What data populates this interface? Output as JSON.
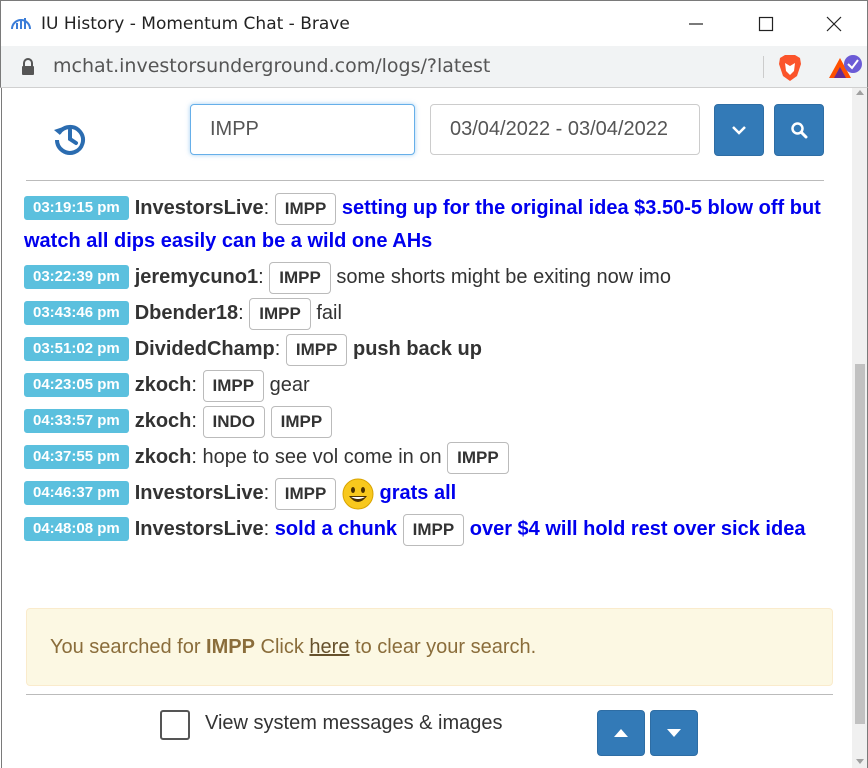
{
  "window": {
    "title": "IU History - Momentum Chat - Brave",
    "url": "mchat.investorsunderground.com/logs/?latest"
  },
  "toolbar": {
    "search_value": "IMPP",
    "date_range": "03/04/2022 - 03/04/2022"
  },
  "messages": [
    {
      "time": "03:19:15 pm",
      "user": "InvestorsLive",
      "parts": [
        {
          "type": "ticker",
          "text": "IMPP"
        },
        {
          "type": "blue",
          "text": "setting up for the original idea $3.50-5 blow off but watch all dips easily can be a wild one AHs"
        }
      ]
    },
    {
      "time": "03:22:39 pm",
      "user": "jeremycuno1",
      "parts": [
        {
          "type": "ticker",
          "text": "IMPP"
        },
        {
          "type": "normal",
          "text": "some shorts might be exiting now imo"
        }
      ]
    },
    {
      "time": "03:43:46 pm",
      "user": "Dbender18",
      "parts": [
        {
          "type": "ticker",
          "text": "IMPP"
        },
        {
          "type": "normal",
          "text": "fail"
        }
      ]
    },
    {
      "time": "03:51:02 pm",
      "user": "DividedChamp",
      "parts": [
        {
          "type": "ticker",
          "text": "IMPP"
        },
        {
          "type": "bold",
          "text": "push back up"
        }
      ]
    },
    {
      "time": "04:23:05 pm",
      "user": "zkoch",
      "parts": [
        {
          "type": "ticker",
          "text": "IMPP"
        },
        {
          "type": "normal",
          "text": "gear"
        }
      ]
    },
    {
      "time": "04:33:57 pm",
      "user": "zkoch",
      "parts": [
        {
          "type": "ticker",
          "text": "INDO"
        },
        {
          "type": "ticker",
          "text": "IMPP"
        }
      ]
    },
    {
      "time": "04:37:55 pm",
      "user": "zkoch",
      "parts": [
        {
          "type": "normal",
          "text": "hope to see vol come in on"
        },
        {
          "type": "ticker",
          "text": "IMPP"
        }
      ]
    },
    {
      "time": "04:46:37 pm",
      "user": "InvestorsLive",
      "parts": [
        {
          "type": "ticker",
          "text": "IMPP"
        },
        {
          "type": "emoji",
          "text": "smiley-emoji"
        },
        {
          "type": "blue",
          "text": "grats all"
        }
      ]
    },
    {
      "time": "04:48:08 pm",
      "user": "InvestorsLive",
      "parts": [
        {
          "type": "blue",
          "text": "sold a chunk"
        },
        {
          "type": "ticker",
          "text": "IMPP"
        },
        {
          "type": "blue",
          "text": "over $4 will hold rest over sick idea"
        }
      ]
    }
  ],
  "alert": {
    "prefix": "You searched for",
    "term": "IMPP",
    "mid": "Click",
    "link": "here",
    "suffix": "to clear your search."
  },
  "footer": {
    "checkbox_label": "View system messages & images"
  },
  "colors": {
    "primary": "#337ab7",
    "time_badge": "#5bc0de",
    "highlight_text": "#0000ee",
    "alert_bg": "#fcf8e3"
  }
}
